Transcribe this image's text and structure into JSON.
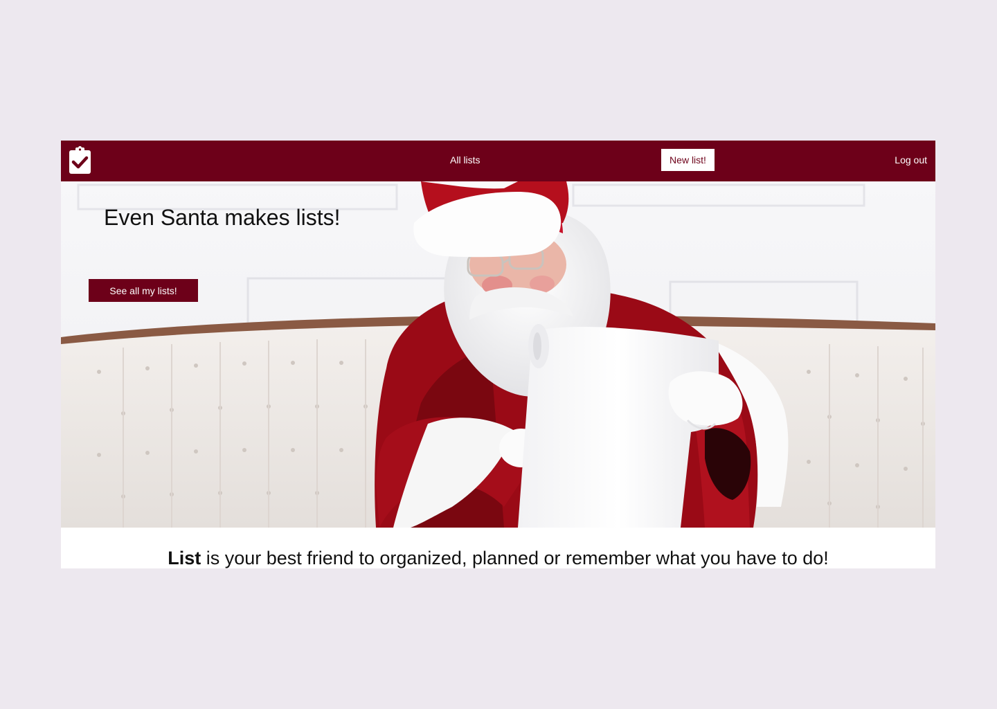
{
  "navbar": {
    "logo_icon": "clipboard-check-icon",
    "all_lists_label": "All lists",
    "new_list_label": "New list!",
    "logout_label": "Log out",
    "bg_color": "#6d0019"
  },
  "hero": {
    "title": "Even Santa makes lists!",
    "button_label": "See all my lists!"
  },
  "tagline": {
    "brand": "List",
    "text": " is your best friend to organized, planned or remember what you have to do!"
  },
  "colors": {
    "accent": "#6d0019",
    "page_background": "#ede8ef"
  }
}
